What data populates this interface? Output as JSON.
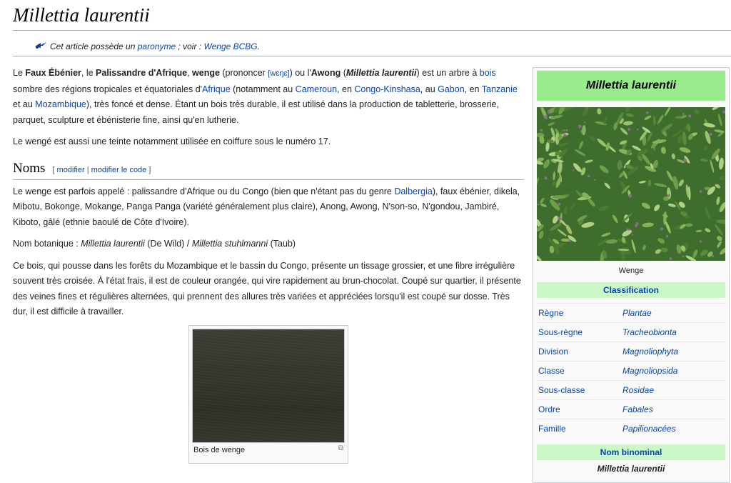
{
  "title": "Millettia laurentii",
  "hatnote": {
    "prefix": "Cet article possède un",
    "link1": "paronyme",
    "mid": " ; voir :",
    "link2": "Wenge BCBG",
    "suffix": "."
  },
  "intro": {
    "p1": {
      "t1": "Le ",
      "b1": "Faux Ébénier",
      "t2": ", le ",
      "b2": "Palissandre d'Afrique",
      "t3": ", ",
      "b3": "wenge",
      "t4": " (prononcer ",
      "ipa": "[wɛŋɛ]",
      "t5": ") ou l'",
      "b4": "Awong",
      "t6": " (",
      "bi1": "Millettia laurentii",
      "t7": ") est un arbre à ",
      "l_bois": "bois",
      "t8": " sombre des régions tropicales et équatoriales d'",
      "l_afrique": "Afrique",
      "t9": " (notamment au ",
      "l_cameroun": "Cameroun",
      "t10": ", en ",
      "l_congo": "Congo-Kinshasa",
      "t11": ", au ",
      "l_gabon": "Gabon",
      "t12": ", en ",
      "l_tanzanie": "Tanzanie",
      "t13": " et au ",
      "l_mozambique": "Mozambique",
      "t14": "), très foncé et dense. Étant un bois très durable, il est utilisé dans la production de tabletterie, brosserie, parquet, sculpture et ébénisterie fine, ainsi qu'en lutherie."
    },
    "p2": "Le wengé est aussi une teinte notamment utilisée en coiffure sous le numéro 17."
  },
  "section_noms": {
    "heading": "Noms",
    "edit_open": "[ ",
    "edit1": "modifier",
    "edit_sep": " | ",
    "edit2": "modifier le code",
    "edit_close": " ]",
    "p1": {
      "t1": "Le wenge est parfois appelé : palissandre d'Afrique ou du Congo (bien que n'étant pas du genre ",
      "l_dalbergia": "Dalbergia",
      "t2": "), faux ébénier, dikela, Mibotu, Bokonge, Mokange, Panga Panga (variété généralement plus claire), Anong, Awong, N'son-so, N'gondou, Jambiré, Kiboto, gâlé (ethnie baoulé de Côte d'Ivoire)."
    },
    "p2": {
      "t1": "Nom botanique : ",
      "i1": "Millettia laurentii",
      "t2": " (De Wild) / ",
      "i2": "Millettia stuhlmanni",
      "t3": " (Taub)"
    },
    "p3": "Ce bois, qui pousse dans les forêts du Mozambique et le bassin du Congo, présente un tissage grossier, et une fibre irrégulière souvent très croisée. À l'état frais, il est de couleur orangée, qui vire rapidement au brun-chocolat. Coupé sur quartier, il présente des veines fines et régulières alternées, qui prennent des allures très variées et appréciées lorsqu'il est coupé sur dosse. Très dur, il est difficile à travailler."
  },
  "thumb_caption": "Bois de wenge",
  "infobox": {
    "title": "Millettia laurentii",
    "photo_caption": "Wenge",
    "classification": "Classification",
    "rows": [
      {
        "k": "Règne",
        "v": "Plantae"
      },
      {
        "k": "Sous-règne",
        "v": "Tracheobionta"
      },
      {
        "k": "Division",
        "v": "Magnoliophyta"
      },
      {
        "k": "Classe",
        "v": "Magnoliopsida"
      },
      {
        "k": "Sous-classe",
        "v": "Rosidae"
      },
      {
        "k": "Ordre",
        "v": "Fabales"
      },
      {
        "k": "Famille",
        "v": "Papilionacées"
      }
    ],
    "binominal_heading": "Nom binominal",
    "binominal": "Millettia laurentii"
  },
  "colors": {
    "link": "#0645ad",
    "infobox_title_bg": "#98ec8c",
    "infobox_band_bg": "#ccf7c6"
  }
}
